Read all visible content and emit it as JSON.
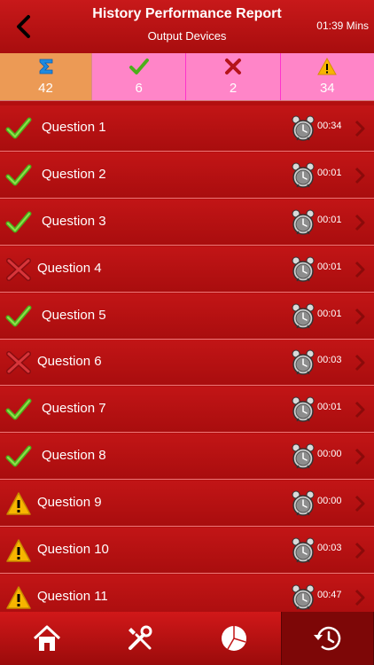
{
  "header": {
    "title": "History Performance Report",
    "subtitle": "Output Devices",
    "time": "01:39 Mins",
    "back_icon": "back-chevron-icon"
  },
  "stats": {
    "total": {
      "icon": "sigma-icon",
      "value": "42"
    },
    "correct": {
      "icon": "check-icon",
      "value": "6"
    },
    "wrong": {
      "icon": "cross-icon",
      "value": "2"
    },
    "unanswered": {
      "icon": "warning-icon",
      "value": "34"
    }
  },
  "questions": [
    {
      "label": "Question 1",
      "status": "correct",
      "time": "00:34"
    },
    {
      "label": "Question 2",
      "status": "correct",
      "time": "00:01"
    },
    {
      "label": "Question 3",
      "status": "correct",
      "time": "00:01"
    },
    {
      "label": "Question 4",
      "status": "wrong",
      "time": "00:01"
    },
    {
      "label": "Question 5",
      "status": "correct",
      "time": "00:01"
    },
    {
      "label": "Question 6",
      "status": "wrong",
      "time": "00:03"
    },
    {
      "label": "Question 7",
      "status": "correct",
      "time": "00:01"
    },
    {
      "label": "Question 8",
      "status": "correct",
      "time": "00:00"
    },
    {
      "label": "Question 9",
      "status": "unanswered",
      "time": "00:00"
    },
    {
      "label": "Question 10",
      "status": "unanswered",
      "time": "00:03"
    },
    {
      "label": "Question 11",
      "status": "unanswered",
      "time": "00:47"
    }
  ],
  "tabbar": {
    "items": [
      {
        "icon": "home-icon",
        "active": false
      },
      {
        "icon": "tools-icon",
        "active": false
      },
      {
        "icon": "pie-chart-icon",
        "active": false
      },
      {
        "icon": "history-icon",
        "active": true
      }
    ]
  },
  "colors": {
    "background": "#b30f10",
    "total_stat": "#ec9a55",
    "stat_pink": "#ff85c8",
    "correct": "#5cc41a",
    "wrong": "#c21517",
    "warning": "#f7b500"
  }
}
